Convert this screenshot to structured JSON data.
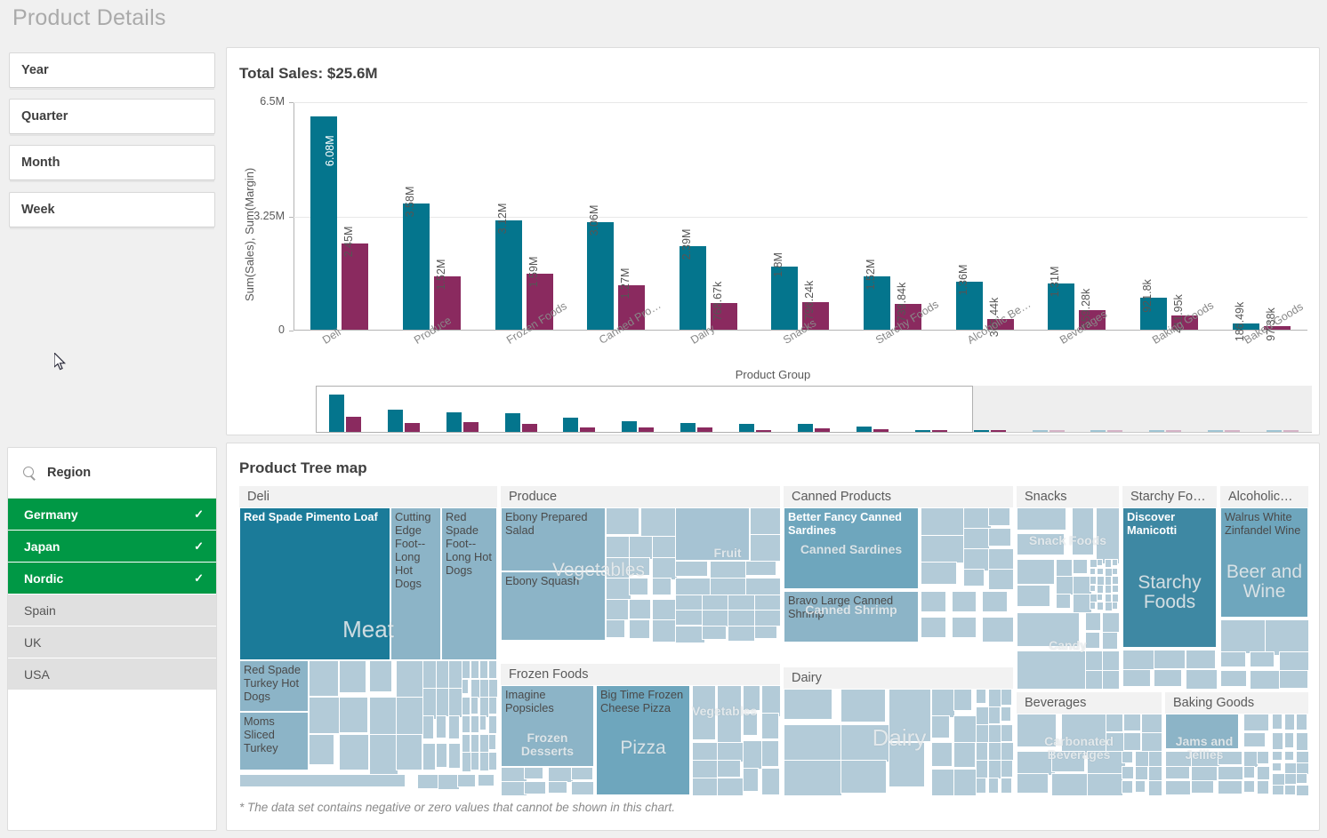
{
  "header": {
    "title": "Product Details"
  },
  "sidebar": {
    "filters": [
      {
        "label": "Year"
      },
      {
        "label": "Quarter"
      },
      {
        "label": "Month"
      },
      {
        "label": "Week"
      }
    ],
    "region": {
      "search_icon": "search-icon",
      "title": "Region",
      "check_glyph": "✓",
      "items": [
        {
          "label": "Germany",
          "selected": true
        },
        {
          "label": "Japan",
          "selected": true
        },
        {
          "label": "Nordic",
          "selected": true
        },
        {
          "label": "Spain",
          "selected": false
        },
        {
          "label": "UK",
          "selected": false
        },
        {
          "label": "USA",
          "selected": false
        }
      ]
    }
  },
  "barchart": {
    "title": "Total Sales: $25.6M",
    "footer_note": ""
  },
  "treemap": {
    "title": "Product Tree map",
    "footnote": "* The data set contains negative or zero values that cannot be shown in this chart.",
    "groups": [
      {
        "name": "Deli",
        "cells": [
          {
            "label": "Red Spade Pimento Loaf",
            "style": "light"
          },
          {
            "label": "Cutting Edge Foot--Long Hot Dogs",
            "style": "plain"
          },
          {
            "label": "Red Spade Foot--Long Hot Dogs",
            "style": "plain"
          },
          {
            "label": "Red Spade Turkey Hot Dogs",
            "style": "plain"
          },
          {
            "label": "Moms Sliced Turkey",
            "style": "plain"
          }
        ],
        "watermarks": [
          "Meat"
        ]
      },
      {
        "name": "Produce",
        "cells": [
          {
            "label": "Ebony Prepared Salad",
            "style": "plain"
          },
          {
            "label": "Ebony Squash",
            "style": "plain"
          }
        ],
        "watermarks": [
          "Vegetables",
          "Fruit"
        ]
      },
      {
        "name": "Frozen Foods",
        "cells": [
          {
            "label": "Imagine Popsicles",
            "style": "plain"
          },
          {
            "label": "Big Time Frozen Cheese Pizza",
            "style": "plain"
          }
        ],
        "watermarks": [
          "Frozen Desserts",
          "Pizza",
          "Vegetables"
        ]
      },
      {
        "name": "Canned Products",
        "cells": [
          {
            "label": "Better Fancy Canned Sardines",
            "style": "light"
          },
          {
            "label": "Bravo Large Canned Shrimp",
            "style": "plain"
          }
        ],
        "watermarks": [
          "Canned Sardines",
          "Canned Shrimp"
        ]
      },
      {
        "name": "Dairy",
        "cells": [],
        "watermarks": [
          "Dairy"
        ]
      },
      {
        "name": "Snacks",
        "cells": [],
        "watermarks": [
          "Snack Foods",
          "Candy"
        ]
      },
      {
        "name": "Starchy Fo…",
        "cells": [
          {
            "label": "Discover Manicotti",
            "style": "light"
          }
        ],
        "watermarks": [
          "Starchy Foods"
        ]
      },
      {
        "name": "Alcoholic…",
        "cells": [
          {
            "label": "Walrus White Zinfandel Wine",
            "style": "plain"
          }
        ],
        "watermarks": [
          "Beer and Wine"
        ]
      },
      {
        "name": "Beverages",
        "cells": [],
        "watermarks": [
          "Carbonated Beverages"
        ]
      },
      {
        "name": "Baking Goods",
        "cells": [],
        "watermarks": [
          "Jams and Jellies"
        ]
      }
    ]
  },
  "colors": {
    "sales": "#04758d",
    "margin": "#8a2a5f",
    "selected_green": "#009845",
    "title_grey": "#aaaaaa"
  },
  "chart_data": {
    "type": "bar",
    "title": "Total Sales: $25.6M",
    "xlabel": "Product Group",
    "ylabel": "Sum(Sales), Sum(Margin)",
    "ylim": [
      0,
      6500000
    ],
    "yticks": [
      0,
      3250000,
      6500000
    ],
    "ytick_labels": [
      "0",
      "3.25M",
      "6.5M"
    ],
    "grid": true,
    "legend": "none",
    "categories": [
      "Deli",
      "Produce",
      "Frozen Foods",
      "Canned Pro…",
      "Dairy",
      "Snacks",
      "Starchy Foods",
      "Alcoholic Be…",
      "Beverages",
      "Baking Goods",
      "Baked Goods"
    ],
    "series": [
      {
        "name": "Sum(Sales)",
        "color": "#04758d",
        "values": [
          6080000,
          3580000,
          3120000,
          3060000,
          2390000,
          1800000,
          1520000,
          1360000,
          1310000,
          921800,
          186490
        ],
        "labels": [
          "6.08M",
          "3.58M",
          "3.12M",
          "3.06M",
          "2.39M",
          "1.8M",
          "1.52M",
          "1.36M",
          "1.31M",
          "921.8k",
          "186.49k"
        ]
      },
      {
        "name": "Sum(Margin)",
        "color": "#8a2a5f",
        "values": [
          2450000,
          1520000,
          1590000,
          1270000,
          768670,
          796240,
          739840,
          305440,
          559280,
          411950,
          97380
        ],
        "labels": [
          "2.45M",
          "1.52M",
          "1.59M",
          "1.27M",
          "768.67k",
          "796.24k",
          "739.84k",
          "305.44k",
          "559.28k",
          "411.95k",
          "97.38k"
        ]
      }
    ],
    "scrollbar": {
      "visible_categories": 11,
      "total_categories": 17,
      "window_start_fraction": 0,
      "window_end_fraction": 0.66
    }
  }
}
